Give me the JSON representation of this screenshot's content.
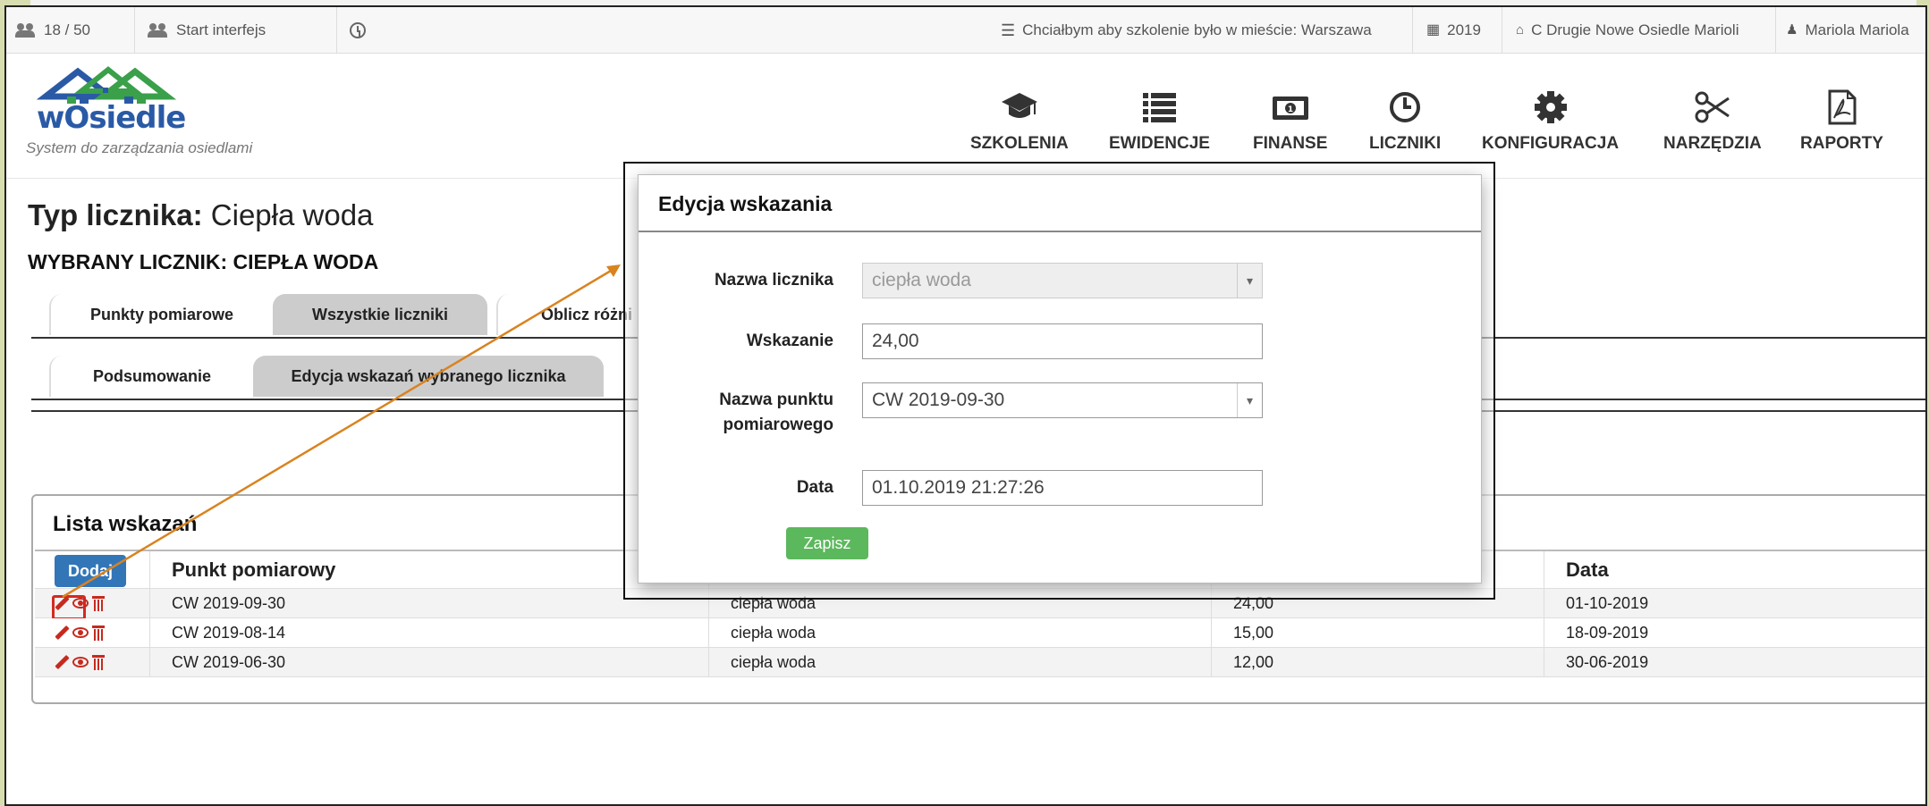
{
  "topbar": {
    "users_count": "18 / 50",
    "start_interface": "Start interfejs",
    "training_city": "Chciałbym aby szkolenie było w mieście: Warszawa",
    "year": "2019",
    "estate": "C Drugie Nowe Osiedle Marioli",
    "user": "Mariola Mariola"
  },
  "logo": {
    "word": "wOsiedle",
    "tagline": "System do zarządzania osiedlami"
  },
  "nav": [
    {
      "label": "SZKOLENIA",
      "icon": "graduation-cap-icon"
    },
    {
      "label": "EWIDENCJE",
      "icon": "list-icon"
    },
    {
      "label": "FINANSE",
      "icon": "money-icon"
    },
    {
      "label": "LICZNIKI",
      "icon": "clock-icon"
    },
    {
      "label": "KONFIGURACJA",
      "icon": "gear-icon"
    },
    {
      "label": "NARZĘDZIA",
      "icon": "scissors-icon"
    },
    {
      "label": "RAPORTY",
      "icon": "pdf-icon"
    }
  ],
  "page": {
    "type_label": "Typ licznika:",
    "type_value": "Ciepła woda",
    "selected_meter": "WYBRANY LICZNIK: CIEPŁA WODA"
  },
  "tabs_row1": [
    "Punkty pomiarowe",
    "Wszystkie liczniki",
    "Oblicz różni"
  ],
  "tabs_row2": [
    "Podsumowanie",
    "Edycja wskazań wybranego licznika"
  ],
  "list": {
    "title": "Lista wskazań",
    "add_button": "Dodaj",
    "columns": [
      "Punkt pomiarowy",
      "",
      "",
      "Data"
    ],
    "rows": [
      {
        "point": "CW 2019-09-30",
        "meter": "ciepła woda",
        "value": "24,00",
        "date": "01-10-2019"
      },
      {
        "point": "CW 2019-08-14",
        "meter": "ciepła woda",
        "value": "15,00",
        "date": "18-09-2019"
      },
      {
        "point": "CW 2019-06-30",
        "meter": "ciepła woda",
        "value": "12,00",
        "date": "30-06-2019"
      }
    ]
  },
  "modal": {
    "title": "Edycja wskazania",
    "meter_name_label": "Nazwa licznika",
    "meter_name_value": "ciepła woda",
    "reading_label": "Wskazanie",
    "reading_value": "24,00",
    "point_label_1": "Nazwa punktu",
    "point_label_2": "pomiarowego",
    "point_value": "CW 2019-09-30",
    "date_label": "Data",
    "date_value": "01.10.2019 21:27:26",
    "save_button": "Zapisz"
  },
  "colors": {
    "accent_blue": "#3276b8",
    "save_green": "#5cb85c",
    "action_red": "#c62a1f",
    "annotation_orange": "#d9831f"
  }
}
